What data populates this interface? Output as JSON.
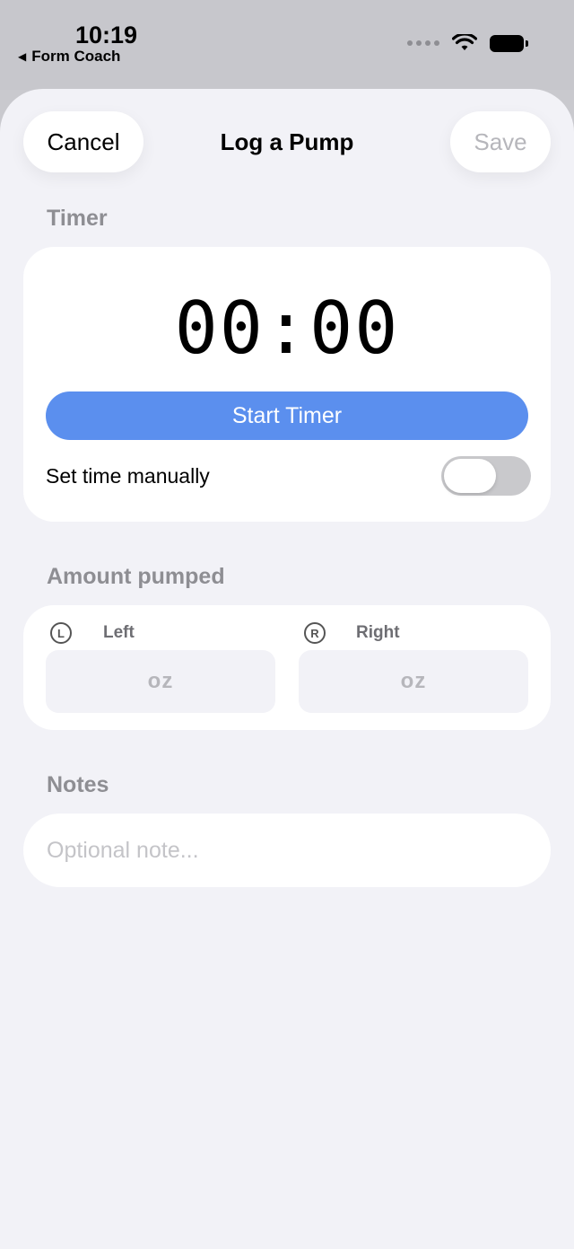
{
  "status_bar": {
    "time": "10:19",
    "back_app": "Form Coach",
    "back_arrow": "◀"
  },
  "nav": {
    "cancel_label": "Cancel",
    "title": "Log a Pump",
    "save_label": "Save"
  },
  "timer": {
    "section_label": "Timer",
    "display": "00:00",
    "start_label": "Start Timer",
    "manual_label": "Set time manually",
    "manual_enabled": false
  },
  "amount": {
    "section_label": "Amount pumped",
    "left": {
      "badge": "L",
      "label": "Left",
      "placeholder": "oz"
    },
    "right": {
      "badge": "R",
      "label": "Right",
      "placeholder": "oz"
    }
  },
  "notes": {
    "section_label": "Notes",
    "placeholder": "Optional note..."
  },
  "colors": {
    "accent": "#5b8fee",
    "background": "#f2f2f7",
    "secondary_text": "#8e8e93"
  }
}
